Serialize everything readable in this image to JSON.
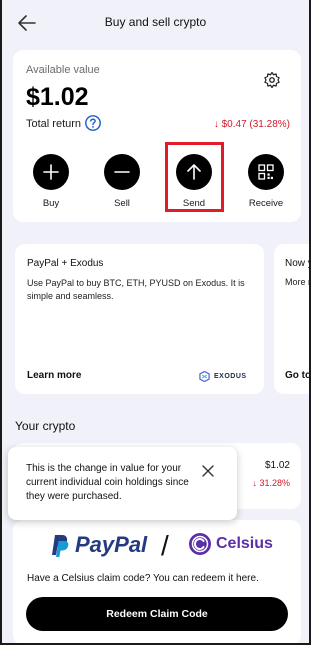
{
  "header": {
    "title": "Buy and sell crypto",
    "back_icon": "arrow-left-icon"
  },
  "summary": {
    "available_label": "Available value",
    "available_value": "$1.02",
    "total_return_label": "Total return",
    "total_return_value": "↓ $0.47 (31.28%)",
    "settings_icon": "gear-icon",
    "help_icon": "question-circle-icon"
  },
  "actions": [
    {
      "label": "Buy",
      "icon": "plus-icon"
    },
    {
      "label": "Sell",
      "icon": "minus-icon"
    },
    {
      "label": "Send",
      "icon": "arrow-up-icon"
    },
    {
      "label": "Receive",
      "icon": "qr-code-icon"
    }
  ],
  "promos": [
    {
      "title": "PayPal + Exodus",
      "description": "Use PayPal to buy BTC, ETH, PYUSD on Exodus. It is simple and seamless.",
      "link": "Learn more",
      "logo_text": "EXODUS"
    },
    {
      "title": "Now y",
      "description": "More r",
      "link": "Go to"
    }
  ],
  "your_crypto": {
    "title": "Your crypto",
    "value": "$1.02",
    "change": "↓ 31.28%"
  },
  "tooltip": {
    "text": "This is the change in value for your current individual coin holdings since they were purchased.",
    "close_icon": "close-icon"
  },
  "claim": {
    "paypal_text": "PayPal",
    "celsius_text": "Celsius",
    "prompt": "Have a Celsius claim code? You can redeem it here.",
    "button": "Redeem Claim Code"
  },
  "colors": {
    "accent_black": "#000000",
    "negative_red": "#d11a2a",
    "highlight_red": "#e21b2a",
    "background": "#f1f2f9",
    "paypal_navy": "#253b80",
    "paypal_blue": "#179bd7",
    "celsius_purple": "#5a2fa8"
  }
}
